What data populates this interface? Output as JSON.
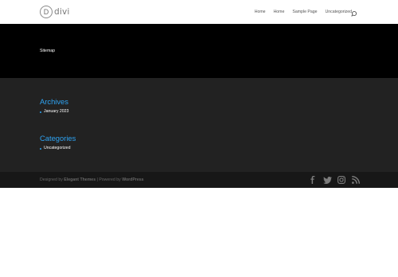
{
  "header": {
    "logo_mark": "D",
    "logo_text": "divi",
    "nav": [
      "Home",
      "Home",
      "Sample Page",
      "Uncategorized"
    ],
    "search_icon": "search-icon"
  },
  "hero": {
    "title": "Sitemap"
  },
  "widgets": {
    "archives": {
      "title": "Archives",
      "items": [
        "January 2023"
      ]
    },
    "categories": {
      "title": "Categories",
      "items": [
        "Uncategorized"
      ]
    }
  },
  "footer": {
    "credit_prefix": "Designed by",
    "credit_theme": "Elegant Themes",
    "credit_sep": "| Powered by",
    "credit_platform": "WordPress",
    "social_icons": [
      "facebook-icon",
      "twitter-icon",
      "instagram-icon",
      "rss-icon"
    ]
  },
  "colors": {
    "accent": "#2ea3f2",
    "hero_bg": "#000000",
    "widgets_bg": "#222222",
    "bottom_bg": "#171717"
  }
}
